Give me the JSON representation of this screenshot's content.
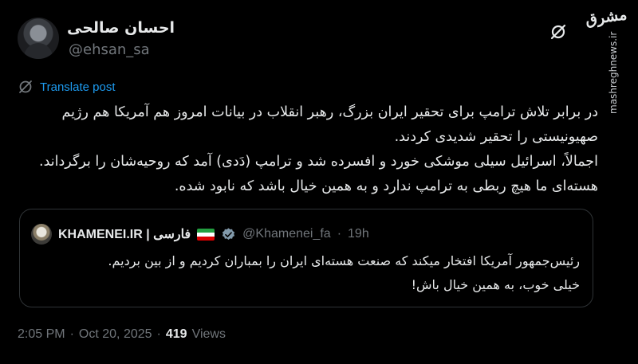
{
  "author": {
    "display_name": "احسان صالحی",
    "handle": "@ehsan_sa"
  },
  "branding": {
    "logo_text": "مشرق",
    "watermark": "mashreghnews.ir"
  },
  "translate_label": "Translate post",
  "tweet": {
    "lines": [
      "در برابر تلاش ترامپ برای تحقیر ایران بزرگ، رهبر انقلاب در بیانات امروز هم آمریکا هم رژیم صهیونیستی را تحقیر شدیدی کردند.",
      "اجمالاً، اسرائیل سیلی موشکی خورد و افسرده شد و ترامپ (دَدی) آمد که روحیه‌شان را برگرداند. هسته‌ای ما هیچ ربطی به ترامپ ندارد و به همین خیال باشد که نابود شده."
    ]
  },
  "quote": {
    "name": "KHAMENEI.IR | فارسی",
    "handle": "@Khamenei_fa",
    "separator": "·",
    "time": "19h",
    "flag_colors": [
      "#239f40",
      "#ffffff",
      "#da0000"
    ],
    "lines": [
      "رئیس‌جمهور آمریکا افتخار میکند که صنعت هسته‌ای ایران را بمباران کردیم و از بین بردیم.",
      "خیلی خوب، به همین خیال باش!"
    ]
  },
  "meta": {
    "time": "2:05 PM",
    "separator": "·",
    "date": "Oct 20, 2025",
    "views_separator": "·",
    "views_count": "419",
    "views_label": "Views"
  },
  "colors": {
    "background": "#000000",
    "text": "#e7e9ea",
    "muted": "#71767b",
    "link": "#1d9bf0",
    "border": "#2f3336"
  },
  "icons": [
    "grok-icon",
    "translate-icon",
    "verified-badge-icon",
    "iran-flag-icon"
  ]
}
